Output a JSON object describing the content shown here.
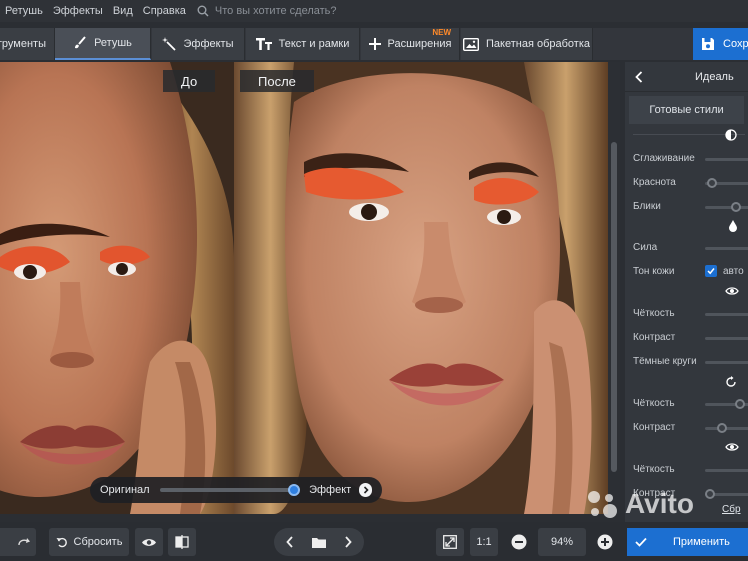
{
  "menu": {
    "items": [
      "Ретушь",
      "Эффекты",
      "Вид",
      "Справка"
    ],
    "search_placeholder": "Что вы хотите сделать?"
  },
  "toolbar": {
    "tabs": [
      {
        "label": "струменты",
        "icon": "tools-icon"
      },
      {
        "label": "Ретушь",
        "icon": "brush-icon"
      },
      {
        "label": "Эффекты",
        "icon": "magic-wand-icon"
      },
      {
        "label": "Текст и рамки",
        "icon": "text-icon"
      },
      {
        "label": "Расширения",
        "icon": "plus-icon",
        "badge": "NEW"
      },
      {
        "label": "Пакетная обработка",
        "icon": "batch-image-icon"
      }
    ],
    "save_label": "Сохра"
  },
  "canvas": {
    "before_label": "До",
    "after_label": "После",
    "compare": {
      "left_label": "Оригинал",
      "right_label": "Эффект",
      "value": 1.0
    }
  },
  "panel": {
    "title": "Идеаль",
    "styles_button": "Готовые стили",
    "rows": [
      {
        "label": "Сглаживание",
        "value": 0.0
      },
      {
        "label": "Краснота",
        "value": 0.1
      },
      {
        "label": "Блики",
        "value": 0.7
      },
      {
        "label": "Сила",
        "value": 0.0
      },
      {
        "label": "Тон кожи",
        "checkbox": "авто"
      },
      {
        "label": "Чёткость",
        "value": 0.0
      },
      {
        "label": "Контраст",
        "value": 0.0
      },
      {
        "label": "Тёмные круги",
        "value": 0.0
      },
      {
        "label": "Чёткость",
        "value": 0.0
      },
      {
        "label": "Контраст",
        "value": 0.25
      },
      {
        "label": "Чёткость",
        "value": 0.0
      },
      {
        "label": "Контраст",
        "value": 0.0
      }
    ],
    "reset_small": "Сбр"
  },
  "bottom": {
    "reset_label": "Сбросить",
    "ratio_label": "1:1",
    "zoom": "94%",
    "apply_label": "Применить"
  },
  "watermark": "Avito",
  "colors": {
    "accent": "#1c6fd1",
    "badge": "#ff8a2a"
  }
}
